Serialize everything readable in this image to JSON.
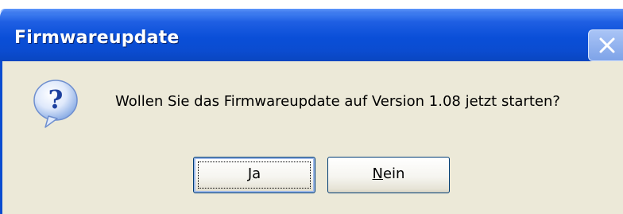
{
  "window": {
    "title": "Firmwareupdate"
  },
  "titlebar": {
    "close_icon": "close-icon"
  },
  "dialog": {
    "icon": "question-icon",
    "message": "Wollen Sie das Firmwareupdate auf Version 1.08 jetzt starten?"
  },
  "buttons": {
    "yes": {
      "mnemonic": "J",
      "rest": "a"
    },
    "no": {
      "mnemonic": "N",
      "rest": "ein"
    }
  },
  "colors": {
    "titlebar": "#0b4cd0",
    "client_background": "#ece9d8",
    "button_border": "#003c74"
  }
}
